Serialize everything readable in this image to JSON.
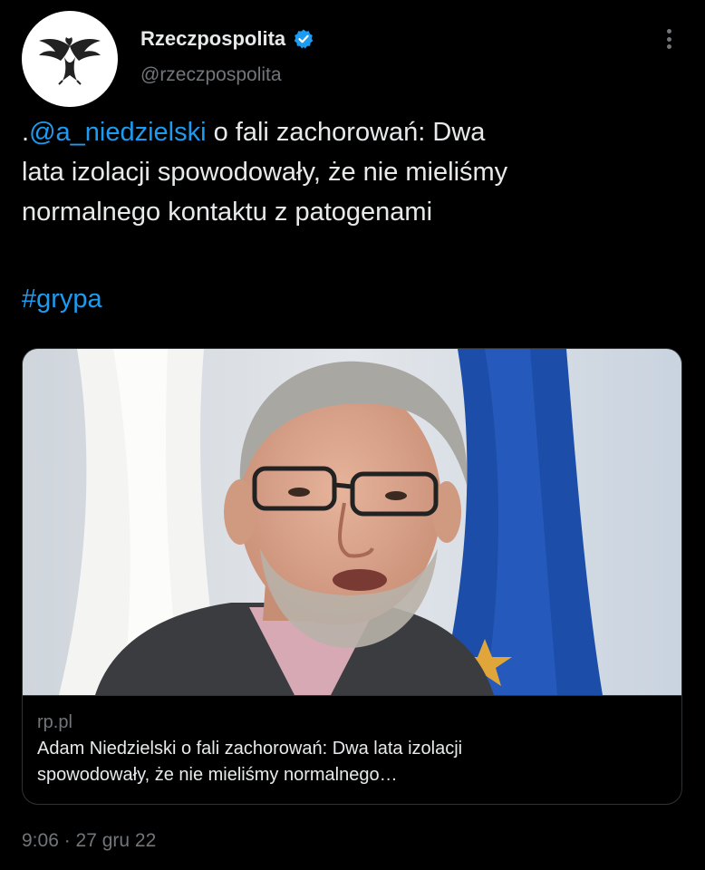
{
  "author": {
    "display_name": "Rzeczpospolita",
    "handle": "@rzeczpospolita",
    "verified_icon": "verified-badge-icon",
    "avatar_icon": "eagle-logo-icon"
  },
  "tweet": {
    "prefix": ".",
    "mention": "@a_niedzielski",
    "text_after_mention": " o fali zachorowań: Dwa\nlata izolacji spowodowały, że nie mieliśmy\nnormalnego kontaktu z patogenami",
    "hashtag": "#grypa"
  },
  "card": {
    "domain": "rp.pl",
    "title": "Adam Niedzielski o fali zachorowań: Dwa lata izolacji spowodowały, że nie mieliśmy normalnego…"
  },
  "timestamp": "9:06 · 27 gru 22",
  "colors": {
    "background": "#000000",
    "text": "#e7e9ea",
    "secondary": "#71767b",
    "link": "#1d9bf0",
    "border": "#2f3336"
  }
}
